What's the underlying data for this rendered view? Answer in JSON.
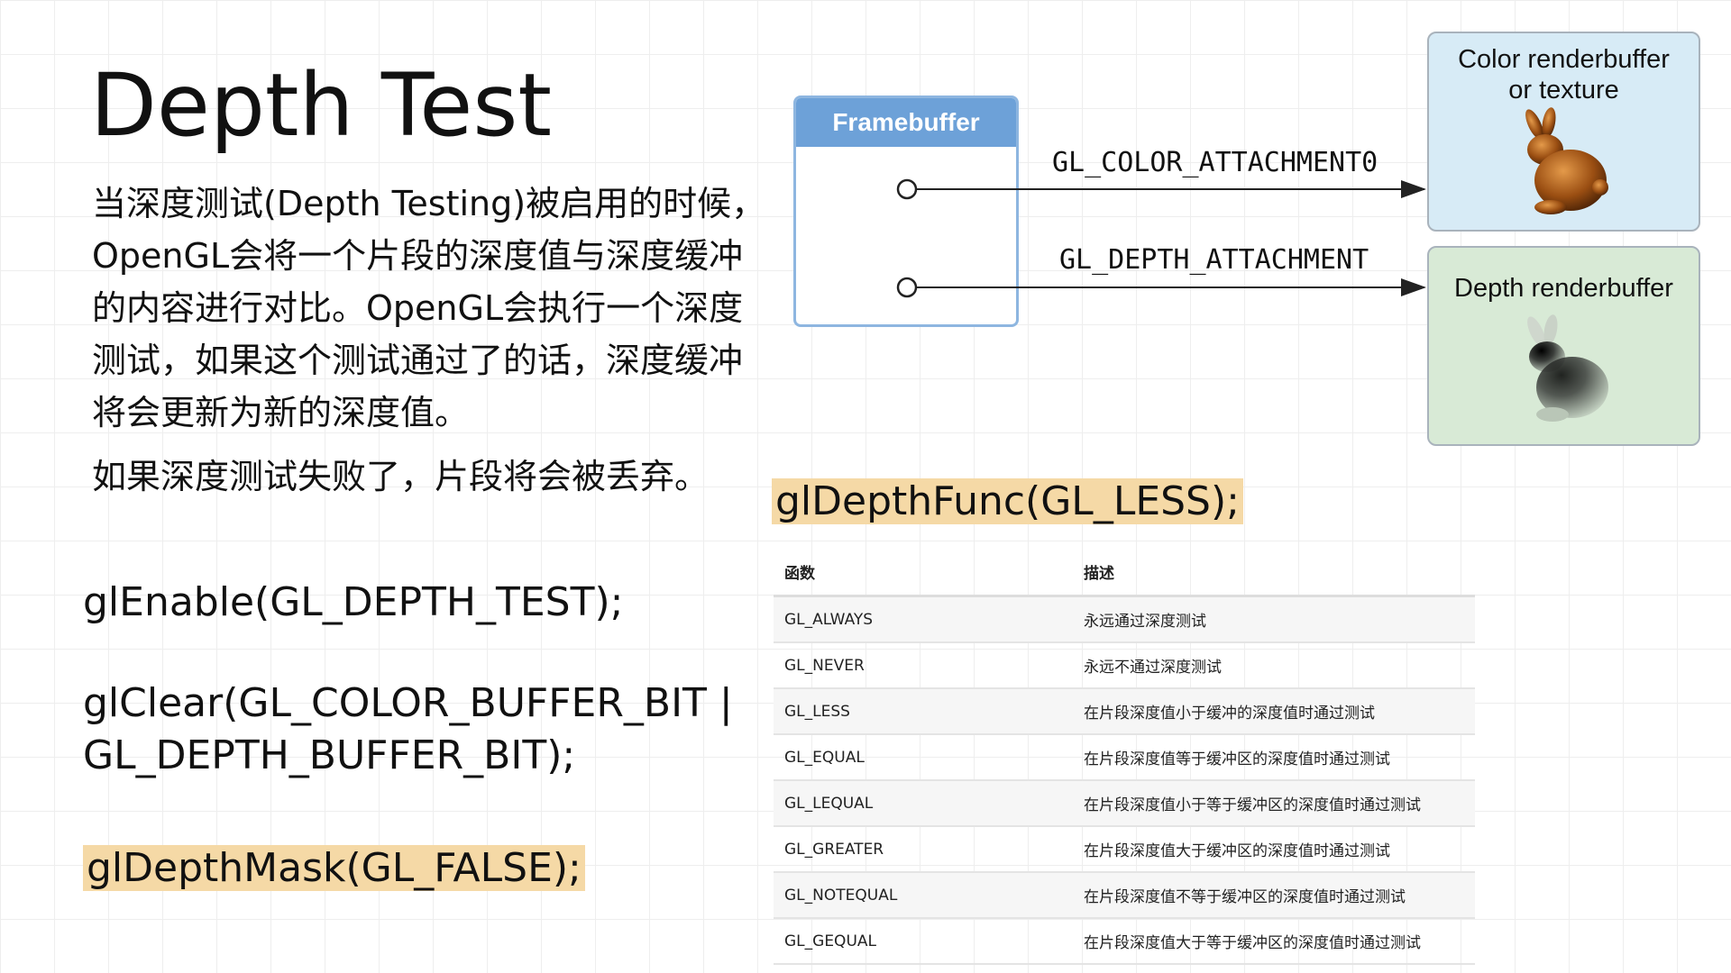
{
  "title": "Depth Test",
  "intro": {
    "paragraph1": "当深度测试(Depth Testing)被启用的时候，OpenGL会将一个片段的深度值与深度缓冲的内容进行对比。OpenGL会执行一个深度测试，如果这个测试通过了的话，深度缓冲将会更新为新的深度值。",
    "paragraph2": "如果深度测试失败了，片段将会被丢弃。"
  },
  "code": {
    "enable": "glEnable(GL_DEPTH_TEST);",
    "clear_line1": "glClear(GL_COLOR_BUFFER_BIT |",
    "clear_line2": "GL_DEPTH_BUFFER_BIT);",
    "mask": "glDepthMask(GL_FALSE);",
    "func": "glDepthFunc(GL_LESS);"
  },
  "diagram": {
    "framebuffer_label": "Framebuffer",
    "color_attachment_label": "GL_COLOR_ATTACHMENT0",
    "depth_attachment_label": "GL_DEPTH_ATTACHMENT",
    "color_box_line1": "Color renderbuffer",
    "color_box_line2": "or texture",
    "depth_box_label": "Depth renderbuffer"
  },
  "table": {
    "headers": [
      "函数",
      "描述"
    ],
    "rows": [
      [
        "GL_ALWAYS",
        "永远通过深度测试"
      ],
      [
        "GL_NEVER",
        "永远不通过深度测试"
      ],
      [
        "GL_LESS",
        "在片段深度值小于缓冲的深度值时通过测试"
      ],
      [
        "GL_EQUAL",
        "在片段深度值等于缓冲区的深度值时通过测试"
      ],
      [
        "GL_LEQUAL",
        "在片段深度值小于等于缓冲区的深度值时通过测试"
      ],
      [
        "GL_GREATER",
        "在片段深度值大于缓冲区的深度值时通过测试"
      ],
      [
        "GL_NOTEQUAL",
        "在片段深度值不等于缓冲区的深度值时通过测试"
      ],
      [
        "GL_GEQUAL",
        "在片段深度值大于等于缓冲区的深度值时通过测试"
      ]
    ]
  },
  "colors": {
    "highlight": "#f5d9a6",
    "framebuffer_header": "#6da1d8",
    "color_box_bg": "#d7ebf6",
    "depth_box_bg": "#d8ead6"
  }
}
